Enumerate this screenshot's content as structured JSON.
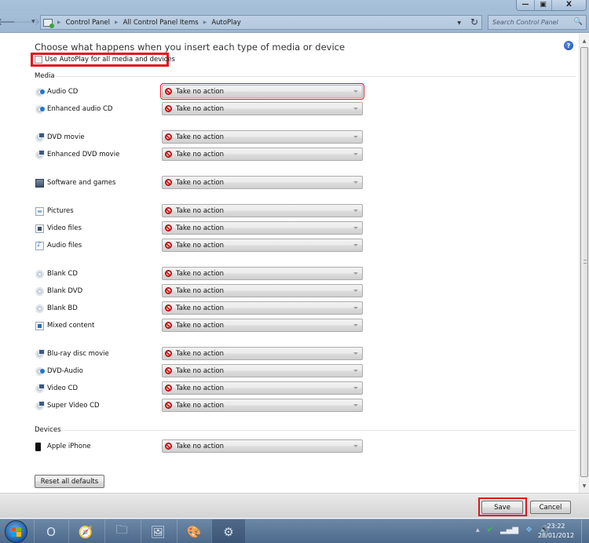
{
  "window": {
    "controls": {
      "minimize": "—",
      "maximize": "▣",
      "close": "X"
    }
  },
  "nav": {
    "back_icon": "arrow-left-icon",
    "forward_icon": "arrow-right-icon",
    "breadcrumb": [
      "Control Panel",
      "All Control Panel Items",
      "AutoPlay"
    ],
    "search_placeholder": "Search Control Panel"
  },
  "page": {
    "heading": "Choose what happens when you insert each type of media or device",
    "autoplay_checkbox": {
      "label": "Use AutoPlay for all media and devices",
      "checked": false
    },
    "help_icon": "?"
  },
  "sections": {
    "media": {
      "title": "Media",
      "items": [
        {
          "label": "Audio CD",
          "icon": "audio-cd-icon",
          "value": "Take no action"
        },
        {
          "label": "Enhanced audio CD",
          "icon": "audio-cd-icon",
          "value": "Take no action"
        },
        {
          "label": "DVD movie",
          "icon": "dvd-movie-icon",
          "value": "Take no action"
        },
        {
          "label": "Enhanced DVD movie",
          "icon": "dvd-movie-icon",
          "value": "Take no action"
        },
        {
          "label": "Software and games",
          "icon": "software-icon",
          "value": "Take no action"
        },
        {
          "label": "Pictures",
          "icon": "pictures-icon",
          "value": "Take no action"
        },
        {
          "label": "Video files",
          "icon": "video-files-icon",
          "value": "Take no action"
        },
        {
          "label": "Audio files",
          "icon": "audio-files-icon",
          "value": "Take no action"
        },
        {
          "label": "Blank CD",
          "icon": "blank-disc-icon",
          "value": "Take no action"
        },
        {
          "label": "Blank DVD",
          "icon": "blank-disc-icon",
          "value": "Take no action"
        },
        {
          "label": "Blank BD",
          "icon": "blank-disc-icon",
          "value": "Take no action"
        },
        {
          "label": "Mixed content",
          "icon": "mixed-content-icon",
          "value": "Take no action"
        },
        {
          "label": "Blu-ray disc movie",
          "icon": "dvd-movie-icon",
          "value": "Take no action"
        },
        {
          "label": "DVD-Audio",
          "icon": "audio-cd-icon",
          "value": "Take no action"
        },
        {
          "label": "Video CD",
          "icon": "dvd-movie-icon",
          "value": "Take no action"
        },
        {
          "label": "Super Video CD",
          "icon": "dvd-movie-icon",
          "value": "Take no action"
        }
      ]
    },
    "devices": {
      "title": "Devices",
      "items": [
        {
          "label": "Apple iPhone",
          "icon": "iphone-icon",
          "value": "Take no action"
        }
      ]
    }
  },
  "buttons": {
    "reset": "Reset all defaults",
    "save": "Save",
    "cancel": "Cancel"
  },
  "taskbar": {
    "clock_time": "23:22",
    "clock_date": "28/01/2012"
  }
}
